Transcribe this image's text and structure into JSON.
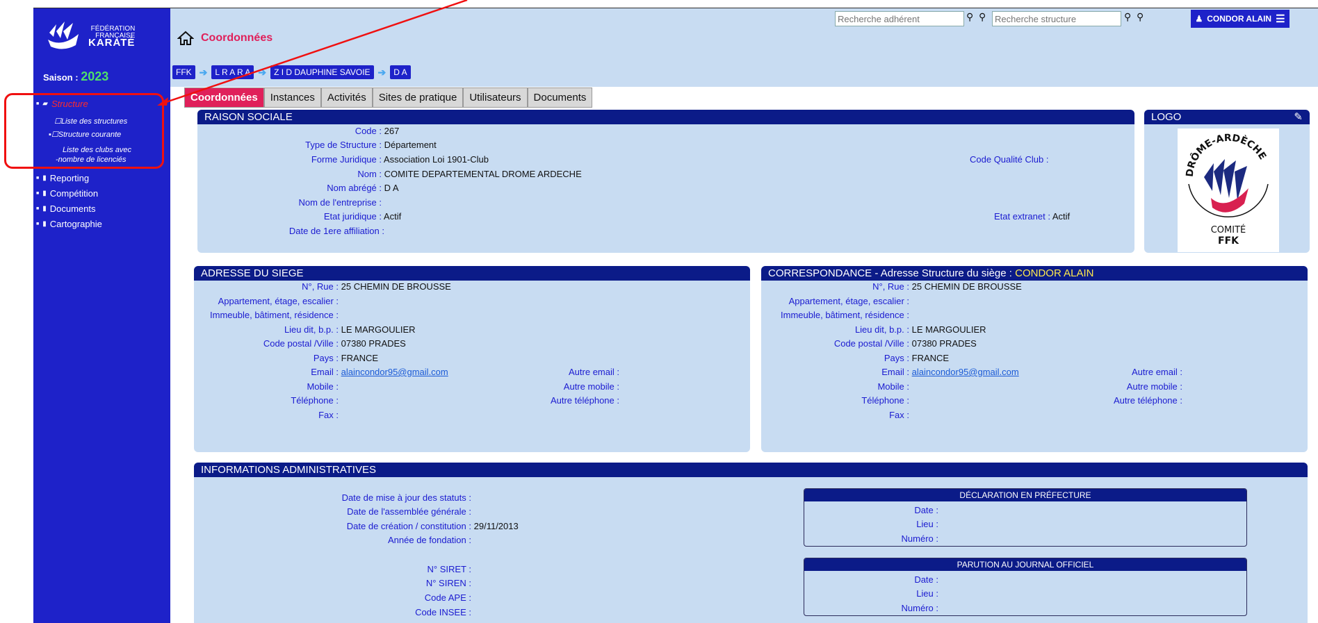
{
  "brand": {
    "line1": "FÉDÉRATION",
    "line2": "FRANÇAISE",
    "line3": "KARATÉ"
  },
  "saison": {
    "label": "Saison :",
    "year": "2023"
  },
  "sidebar": {
    "structure": "Structure",
    "subs": [
      "Liste des structures",
      "Structure courante",
      "Liste des clubs avec",
      "-nombre de licenciés"
    ],
    "items": [
      "Reporting",
      "Compétition",
      "Documents",
      "Cartographie"
    ]
  },
  "header": {
    "title": "Coordonnées",
    "search_member": "Recherche adhérent",
    "search_structure": "Recherche structure",
    "user": "CONDOR ALAIN"
  },
  "breadcrumb": [
    "FFK",
    "L R A R A",
    "Z I D DAUPHINE SAVOIE",
    "D A"
  ],
  "tabs": [
    "Coordonnées",
    "Instances",
    "Activités",
    "Sites de pratique",
    "Utilisateurs",
    "Documents"
  ],
  "raison": {
    "title": "RAISON SOCIALE",
    "code_l": "Code :",
    "code": "267",
    "type_l": "Type de Structure :",
    "type": "Département",
    "forme_l": "Forme Juridique :",
    "forme": "Association Loi 1901-Club",
    "qualite_l": "Code Qualité Club :",
    "nom_l": "Nom :",
    "nom": "COMITE DEPARTEMENTAL DROME ARDECHE",
    "abrege_l": "Nom abrégé :",
    "abrege": "D A",
    "entreprise_l": "Nom de l'entreprise :",
    "etat_l": "Etat juridique :",
    "etat": "Actif",
    "extranet_l": "Etat extranet :",
    "extranet": "Actif",
    "affil_l": "Date de 1ere affiliation :"
  },
  "logo": {
    "title": "LOGO",
    "arc": "DRÔME-ARDÈCHE",
    "c1": "COMITÉ",
    "c2": "FFK"
  },
  "siege": {
    "title": "ADRESSE DU SIEGE",
    "rue_l": "N°, Rue :",
    "rue": "25 CHEMIN DE BROUSSE",
    "appt_l": "Appartement, étage, escalier :",
    "imm_l": "Immeuble, bâtiment, résidence :",
    "lieu_l": "Lieu dit, b.p. :",
    "lieu": "LE MARGOULIER",
    "cp_l": "Code postal /Ville :",
    "cp": "07380  PRADES",
    "pays_l": "Pays :",
    "pays": "FRANCE",
    "email_l": "Email :",
    "email": "alaincondor95@gmail.com",
    "aemail_l": "Autre email :",
    "mobile_l": "Mobile :",
    "amobile_l": "Autre mobile :",
    "tel_l": "Téléphone :",
    "atel_l": "Autre téléphone :",
    "fax_l": "Fax :"
  },
  "corresp": {
    "title": "CORRESPONDANCE - Adresse Structure du siège : ",
    "name": "CONDOR ALAIN"
  },
  "admin": {
    "title": "INFORMATIONS ADMINISTRATIVES",
    "maj_l": "Date de mise à jour des statuts :",
    "ag_l": "Date de l'assemblée générale :",
    "creation_l": "Date de création / constitution :",
    "creation": "29/11/2013",
    "fond_l": "Année de fondation :",
    "siret_l": "N° SIRET :",
    "siren_l": "N° SIREN :",
    "ape_l": "Code APE :",
    "insee_l": "Code INSEE :",
    "pref_title": "DÉCLARATION EN PRÉFECTURE",
    "jo_title": "PARUTION AU JOURNAL OFFICIEL",
    "date_l": "Date :",
    "lieu_l": "Lieu :",
    "num_l": "Numéro :"
  }
}
